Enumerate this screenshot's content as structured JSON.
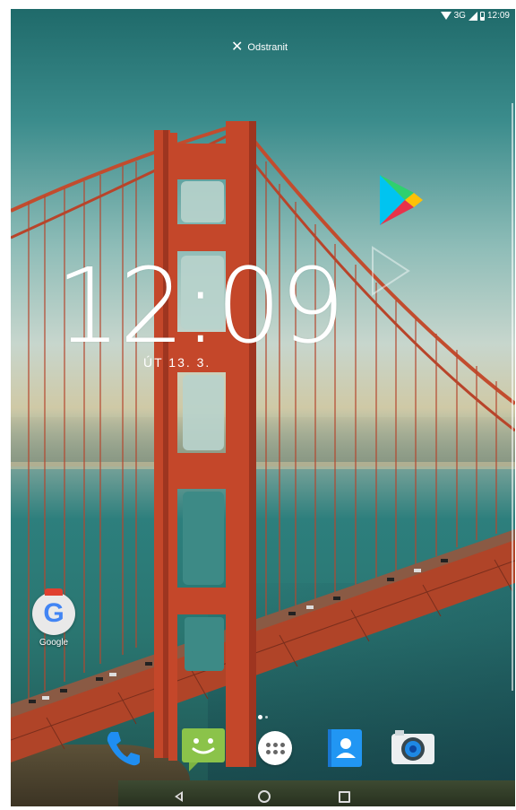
{
  "status_bar": {
    "network": "3G",
    "time": "12:09",
    "icons": [
      "wifi-icon",
      "signal-icon",
      "battery-icon"
    ]
  },
  "remove_target": {
    "icon": "close-icon",
    "label": "Odstranit"
  },
  "clock": {
    "time": "12:09",
    "date": "ÚT 13. 3."
  },
  "dragged_app": {
    "icon": "play-store-icon"
  },
  "home_widgets": [
    {
      "label": "Google",
      "icon": "google-icon"
    }
  ],
  "dock": {
    "items": [
      {
        "name": "phone",
        "icon": "phone-icon"
      },
      {
        "name": "messaging",
        "icon": "messaging-icon"
      },
      {
        "name": "all-apps",
        "icon": "apps-drawer-icon"
      },
      {
        "name": "contacts",
        "icon": "contacts-icon"
      },
      {
        "name": "camera",
        "icon": "camera-icon"
      }
    ]
  },
  "nav_bar": {
    "buttons": [
      "back",
      "home",
      "recents"
    ]
  },
  "colors": {
    "bridge": "#c0462a",
    "water": "#2a7671",
    "sky": "#8fbdb8"
  }
}
